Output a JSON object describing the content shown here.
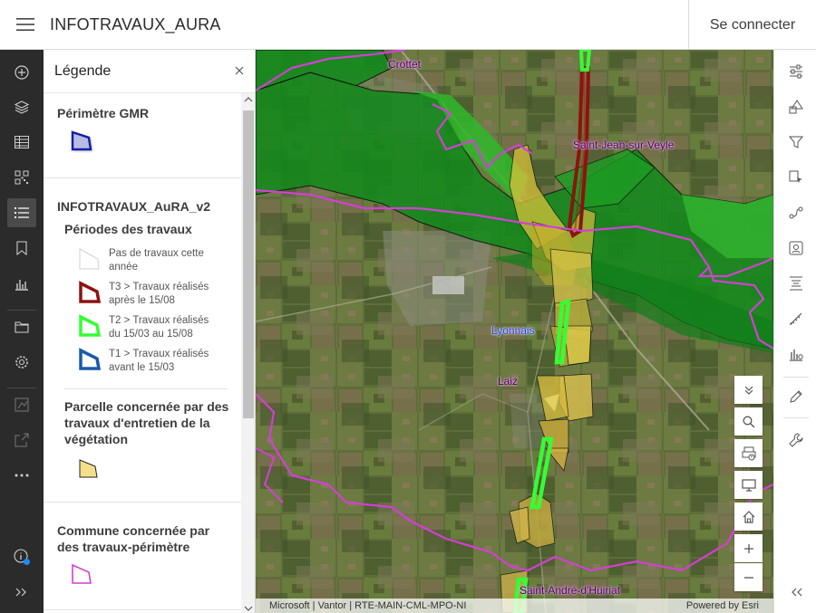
{
  "header": {
    "title": "INFOTRAVAUX_AURA",
    "signin_label": "Se connecter"
  },
  "left_toolbar": {
    "items": [
      {
        "icon": "add-icon"
      },
      {
        "icon": "layers-icon"
      },
      {
        "icon": "table-icon"
      },
      {
        "icon": "qr-code-icon"
      },
      {
        "icon": "legend-list-icon",
        "active": true
      },
      {
        "icon": "bookmark-icon"
      },
      {
        "icon": "chart-icon"
      },
      {
        "icon": "folder-icon"
      },
      {
        "icon": "gear-icon"
      },
      {
        "icon": "analysis-icon"
      },
      {
        "icon": "share-icon"
      },
      {
        "icon": "more-icon"
      },
      {
        "icon": "info-icon"
      },
      {
        "icon": "expand-icon"
      }
    ]
  },
  "legend": {
    "title": "Légende",
    "sections": [
      {
        "title": "Périmètre GMR"
      },
      {
        "title": "INFOTRAVAUX_AuRA_v2",
        "subtitle": "Périodes des travaux",
        "items": [
          {
            "label": "Pas de travaux cette année",
            "stroke": "#d8d8d8"
          },
          {
            "label": "T3 > Travaux réalisés après le 15/08",
            "stroke": "#8b1410"
          },
          {
            "label": "T2 > Travaux réalisés du 15/03 au 15/08",
            "stroke": "#33ff33"
          },
          {
            "label": "T1 > Travaux réalisés avant le 15/03",
            "stroke": "#1a5aa6"
          }
        ],
        "subtitle2": "Parcelle concernée par des travaux d'entretien de la végétation"
      },
      {
        "title": "Commune concernée par des travaux-périmètre"
      }
    ]
  },
  "map": {
    "labels": {
      "crottet": "Crottet",
      "saint_jean": "Saint-Jean-sur-Veyle",
      "lyonnais": "Lyonnais",
      "laiz": "Laiz",
      "saint_andre": "Saint-André-d'Huiriat"
    },
    "attribution": "Microsoft | Vantor | RTE-MAIN-CML-MPO-NI",
    "powered_by": "Powered by Esri",
    "colors": {
      "commune_boundary": "#d43fd6",
      "gmr_green_dark": "#138a1d",
      "gmr_green": "#2fae2c",
      "parcel_yellow": "#d8c23a",
      "t3": "#8b1410",
      "t2": "#33ff33"
    }
  },
  "map_controls": [
    {
      "icon": "chevrons-down-icon"
    },
    {
      "icon": "search-icon"
    },
    {
      "icon": "print-icon"
    },
    {
      "icon": "fullscreen-icon"
    },
    {
      "icon": "home-icon"
    },
    {
      "icon": "zoom-in-icon"
    },
    {
      "icon": "zoom-out-icon"
    }
  ],
  "right_toolbar": {
    "items": [
      {
        "icon": "sliders-icon"
      },
      {
        "icon": "shapes-icon"
      },
      {
        "icon": "filter-icon"
      },
      {
        "icon": "select-icon"
      },
      {
        "icon": "directions-icon"
      },
      {
        "icon": "near-me-icon"
      },
      {
        "icon": "align-icon"
      },
      {
        "icon": "measure-icon"
      },
      {
        "icon": "chart-settings-icon"
      },
      {
        "icon": "edit-icon"
      },
      {
        "icon": "wrench-icon"
      },
      {
        "icon": "collapse-icon"
      }
    ]
  }
}
